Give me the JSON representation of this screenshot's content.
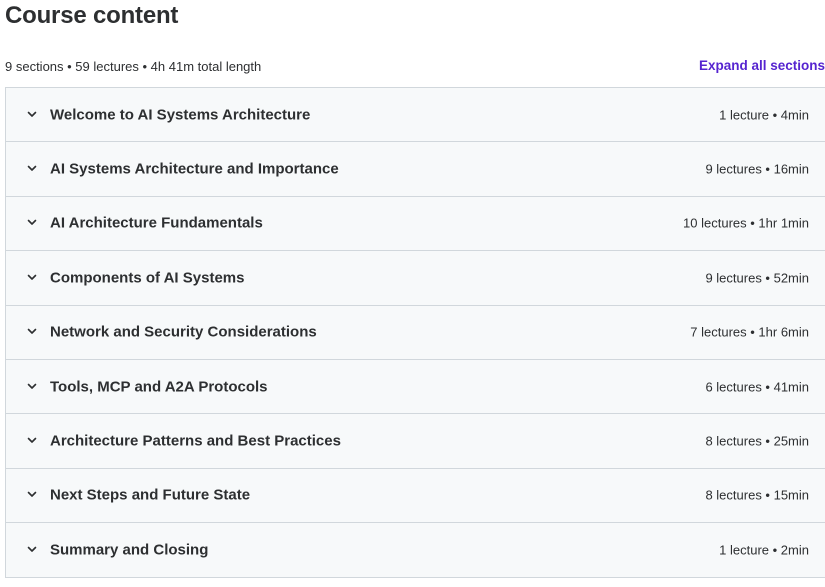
{
  "header": {
    "title": "Course content",
    "summary": "9 sections • 59 lectures • 4h 41m total length",
    "expand_label": "Expand all sections"
  },
  "colors": {
    "accent": "#5624d0",
    "row_background": "#f7f9fa",
    "border": "#d1d7dc",
    "text": "#2d2f31"
  },
  "icons": {
    "section_toggle": "chevron-down-icon"
  },
  "sections": [
    {
      "title": "Welcome to AI Systems Architecture",
      "meta": "1 lecture • 4min"
    },
    {
      "title": "AI Systems Architecture and Importance",
      "meta": "9 lectures • 16min"
    },
    {
      "title": "AI Architecture Fundamentals",
      "meta": "10 lectures • 1hr 1min"
    },
    {
      "title": "Components of AI Systems",
      "meta": "9 lectures • 52min"
    },
    {
      "title": "Network and Security Considerations",
      "meta": "7 lectures • 1hr 6min"
    },
    {
      "title": "Tools, MCP and A2A Protocols",
      "meta": "6 lectures • 41min"
    },
    {
      "title": "Architecture Patterns and Best Practices",
      "meta": "8 lectures • 25min"
    },
    {
      "title": "Next Steps and Future State",
      "meta": "8 lectures • 15min"
    },
    {
      "title": "Summary and Closing",
      "meta": "1 lecture • 2min"
    }
  ]
}
